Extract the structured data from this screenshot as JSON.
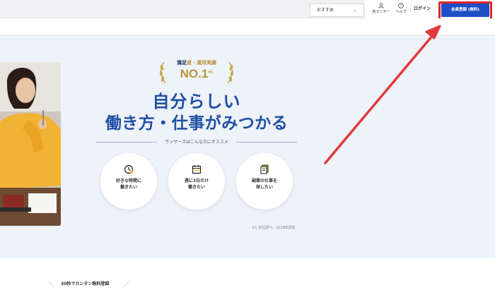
{
  "header": {
    "select_value": "おすすめ",
    "nav": [
      {
        "label": "他ランサー",
        "icon": "person-icon"
      },
      {
        "label": "ヘルプ",
        "icon": "help-icon"
      }
    ],
    "login_label": "ログイン",
    "register_label": "会員登録 (無料)"
  },
  "hero": {
    "badge_highlight": "満足",
    "badge_rest": "度・運用実績",
    "badge_no1": "NO.1",
    "badge_note": "※1",
    "headline_line1": "自分らしい",
    "headline_line2": "働き方・仕事がみつかる",
    "recommend_text": "ランサーズはこんな方にオススメ",
    "features": [
      {
        "line1": "好きな時間に",
        "line2": "働きたい",
        "icon": "clock-icon"
      },
      {
        "line1": "週に3日だけ",
        "line2": "働きたい",
        "icon": "calendar-icon"
      },
      {
        "line1": "副業の仕事を",
        "line2": "探したい",
        "icon": "document-icon"
      }
    ],
    "footnote": "※1 当社調べ、2018年調査"
  },
  "cta": {
    "text": "30秒でカンタン無料登録"
  },
  "colors": {
    "brand_blue": "#1e4fa5",
    "button_blue": "#1e4fc7",
    "gold": "#b8953a",
    "highlight_red": "#e02424",
    "hero_bg": "#eef2f9"
  }
}
